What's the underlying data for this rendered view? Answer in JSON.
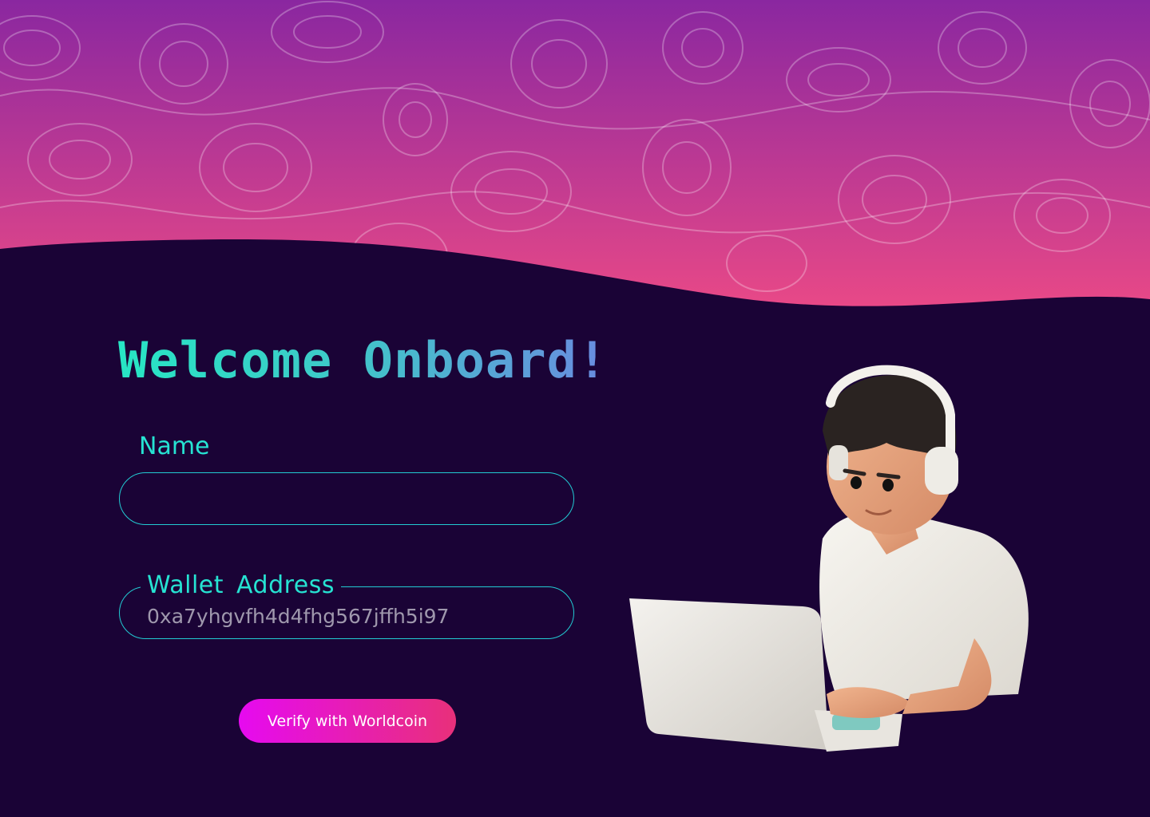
{
  "page": {
    "title": "Welcome Onboard!"
  },
  "form": {
    "name_label": "Name",
    "name_value": "",
    "wallet_label": "Wallet Address",
    "wallet_value": "0xa7yhgvfh4d4fhg567jffh5i97"
  },
  "actions": {
    "verify_label": "Verify with Worldcoin"
  },
  "colors": {
    "background": "#1a0336",
    "hero_top": "#8a27a0",
    "hero_bottom": "#ec4a86",
    "accent_teal": "#26e3d2",
    "button_start": "#e60af0",
    "button_end": "#e8307a"
  },
  "illustration": {
    "subject": "person-with-headphones-typing-on-laptop"
  }
}
